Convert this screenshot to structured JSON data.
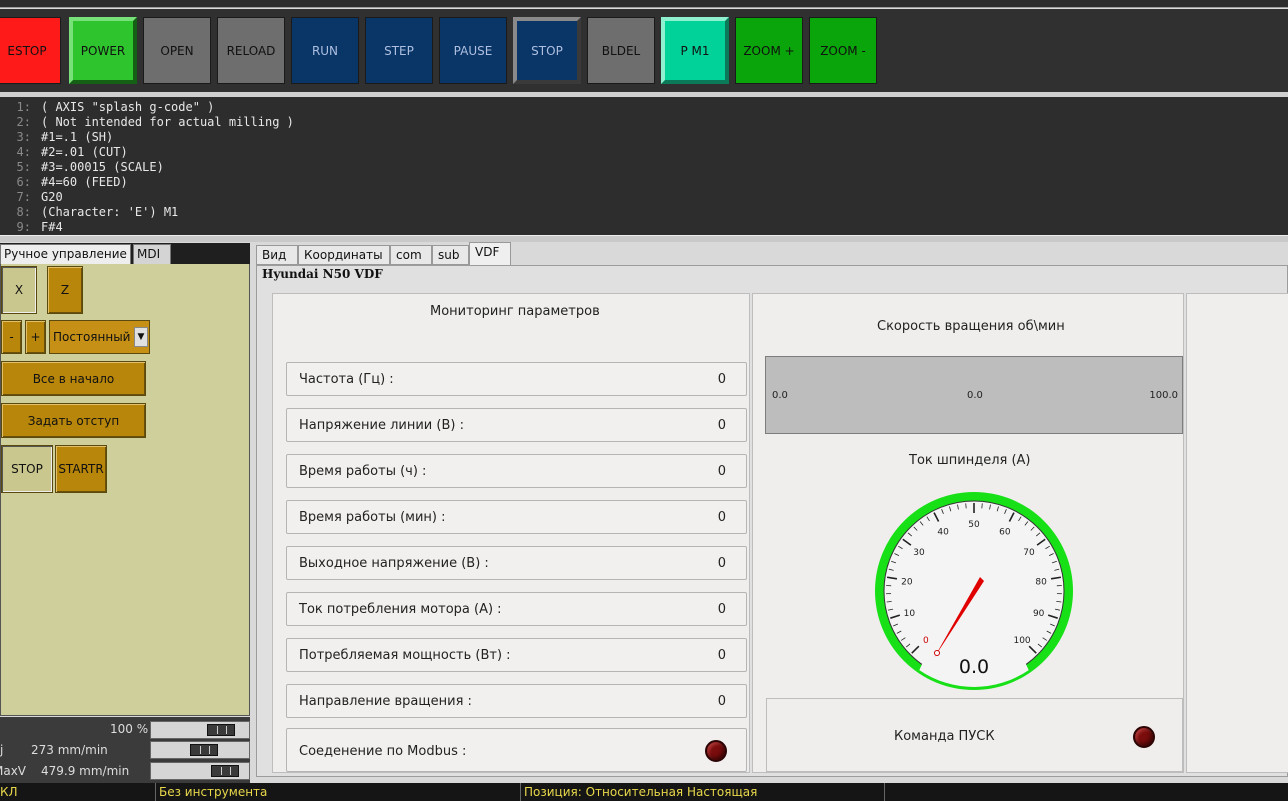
{
  "toolbar": {
    "estop": "ESTOP",
    "power": "POWER",
    "open": "OPEN",
    "reload": "RELOAD",
    "run": "RUN",
    "step": "STEP",
    "pause": "PAUSE",
    "stop": "STOP",
    "bldel": "BLDEL",
    "pm1": "P M1",
    "zoom_in": "ZOOM +",
    "zoom_out": "ZOOM -"
  },
  "gcode": {
    "lines": [
      {
        "num": "1:",
        "text": "( AXIS \"splash g-code\" )"
      },
      {
        "num": "2:",
        "text": "( Not intended for actual milling )"
      },
      {
        "num": "3:",
        "text": "#1=.1 (SH)"
      },
      {
        "num": "4:",
        "text": "#2=.01 (CUT)"
      },
      {
        "num": "5:",
        "text": "#3=.00015 (SCALE)"
      },
      {
        "num": "6:",
        "text": "#4=60 (FEED)"
      },
      {
        "num": "7:",
        "text": "G20"
      },
      {
        "num": "8:",
        "text": "(Character: 'E') M1"
      },
      {
        "num": "9:",
        "text": "F#4"
      }
    ]
  },
  "left": {
    "tab_manual": "Ручное управление",
    "tab_mdi": "MDI",
    "axis_x": "X",
    "axis_z": "Z",
    "minus": "-",
    "plus": "+",
    "jog_mode": "Постоянный",
    "home_all": "Все в начало",
    "set_offset": "Задать отступ",
    "spindle_stop": "STOP",
    "spindle_start": "STARTR",
    "feed_override": "100 %",
    "jog_label": "j",
    "jog_speed": "273 mm/min",
    "maxv_label": "MaxV",
    "maxv_speed": "479.9 mm/min",
    "feed_override_level": 0.8,
    "jog_speed_level": 0.55,
    "maxv_level": 0.85
  },
  "tabs": [
    "Вид",
    "Координаты",
    "com",
    "sub",
    "VDF"
  ],
  "vdf": {
    "title": "Hyundai N50 VDF",
    "monitor_title": "Мониторинг параметров",
    "params": [
      {
        "label": "Частота (Гц) :",
        "value": "0"
      },
      {
        "label": "Напряжение линии (В) :",
        "value": "0"
      },
      {
        "label": "Время работы (ч) :",
        "value": "0"
      },
      {
        "label": "Время работы (мин) :",
        "value": "0"
      },
      {
        "label": "Выходное напряжение (В) :",
        "value": "0"
      },
      {
        "label": "Ток потребления мотора (А) :",
        "value": "0"
      },
      {
        "label": "Потребляемая мощность (Вт) :",
        "value": "0"
      },
      {
        "label": "Направление вращения :",
        "value": "0"
      }
    ],
    "modbus_label": "Соеденение по Modbus :",
    "speed_title": "Скорость вращения об\\мин",
    "speed_min": "0.0",
    "speed_value": "0.0",
    "speed_max": "100.0",
    "current_title": "Ток шпинделя (А)",
    "gauge_ticks": [
      "0",
      "10",
      "20",
      "30",
      "40",
      "50",
      "60",
      "70",
      "80",
      "90",
      "100"
    ],
    "gauge_value": "0.0",
    "start_cmd": "Команда ПУСК"
  },
  "colors": {
    "estop": "#ff1a1a",
    "power": "#2ec42e",
    "gauge_ring": "#17e017",
    "needle": "#e00000",
    "lamp": "#7a0d0d",
    "status_text": "#e8d84a"
  },
  "status": {
    "mode": "КЛ",
    "tool": "Без инструмента",
    "position": "Позиция: Относительная Настоящая"
  }
}
